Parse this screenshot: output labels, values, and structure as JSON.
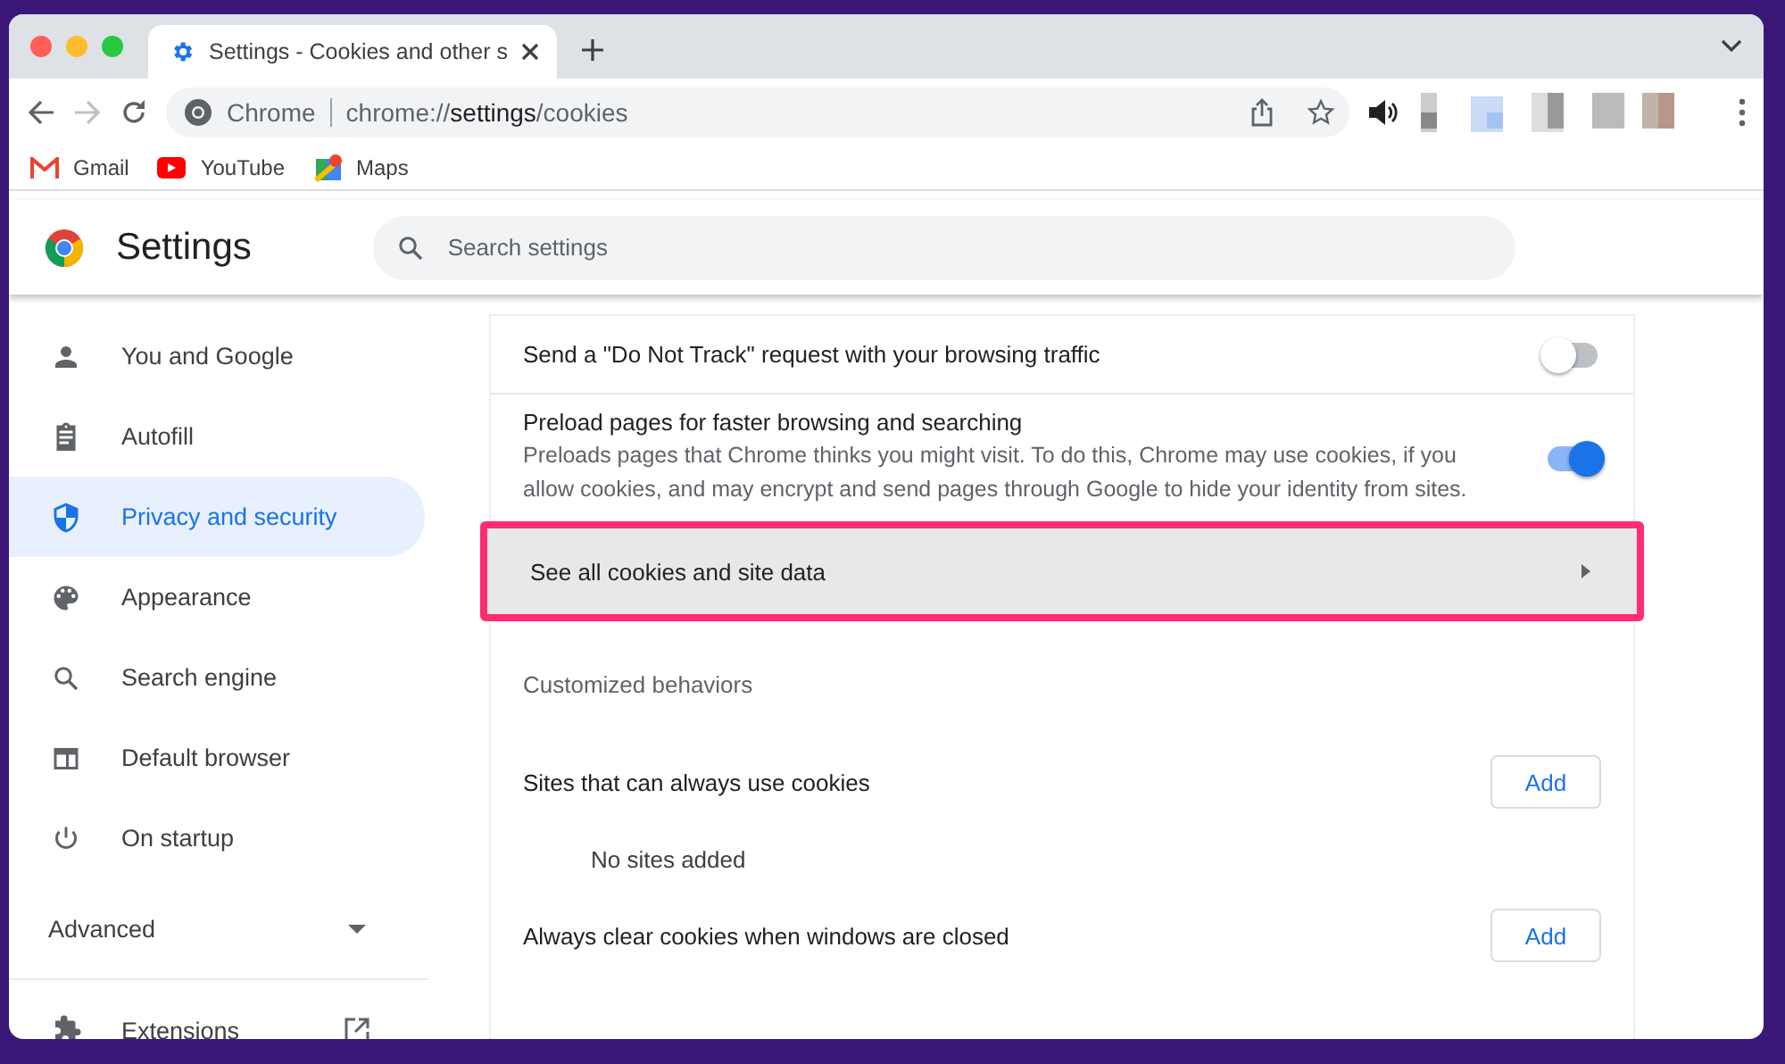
{
  "tabs": [
    {
      "title": "Settings - Cookies and other s",
      "selected": true
    }
  ],
  "address_bar": {
    "site_label": "Chrome",
    "url": "chrome://**settings**/cookies"
  },
  "bookmarks": [
    {
      "label": "Gmail",
      "kind": "gmail"
    },
    {
      "label": "YouTube",
      "kind": "youtube"
    },
    {
      "label": "Maps",
      "kind": "maps"
    }
  ],
  "header": {
    "title": "Settings",
    "search_placeholder": "Search settings"
  },
  "sidebar": {
    "items": [
      {
        "label": "You and Google",
        "kind": "person",
        "selected": false
      },
      {
        "label": "Autofill",
        "kind": "clipboard",
        "selected": false
      },
      {
        "label": "Privacy and security",
        "kind": "shield",
        "selected": true
      },
      {
        "label": "Appearance",
        "kind": "palette",
        "selected": false
      },
      {
        "label": "Search engine",
        "kind": "search",
        "selected": false
      },
      {
        "label": "Default browser",
        "kind": "browser",
        "selected": false
      },
      {
        "label": "On startup",
        "kind": "power",
        "selected": false
      }
    ],
    "advanced": {
      "label": "Advanced",
      "expanded": false
    },
    "extensions": {
      "label": "Extensions"
    }
  },
  "content": {
    "rows": [
      {
        "kind": "toggle",
        "title": "Send a \"Do Not Track\" request with your browsing traffic",
        "on": false
      },
      {
        "kind": "toggle",
        "title": "Preload pages for faster browsing and searching",
        "description": "Preloads pages that Chrome thinks you might visit. To do this, Chrome may use cookies, if you allow cookies, and may encrypt and send pages through Google to hide your identity from sites.",
        "on": true
      },
      {
        "kind": "link",
        "title": "See all cookies and site data",
        "highlighted": true
      },
      {
        "kind": "heading",
        "title": "Customized behaviors"
      },
      {
        "kind": "section",
        "title": "Sites that can always use cookies",
        "button": "Add",
        "empty_text": "No sites added"
      },
      {
        "kind": "section",
        "title": "Always clear cookies when windows are closed",
        "button": "Add"
      }
    ]
  }
}
